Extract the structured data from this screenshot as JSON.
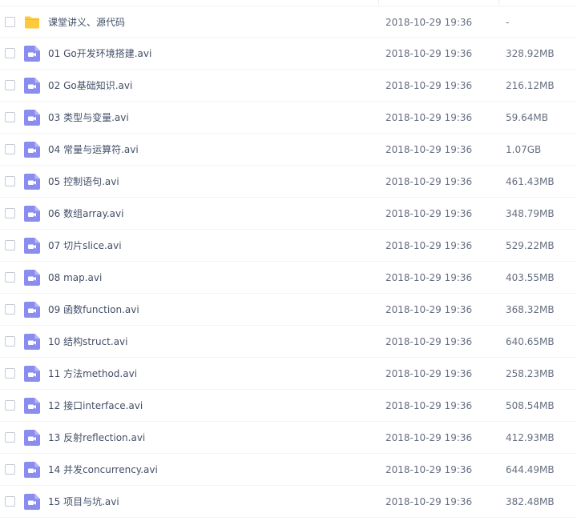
{
  "icon_colors": {
    "folder": "#ffc93c",
    "video": "#8a8cf0"
  },
  "files": [
    {
      "name": "课堂讲义、源代码",
      "date": "2018-10-29 19:36",
      "size": "-",
      "icon": "folder-icon"
    },
    {
      "name": "01 Go开发环境搭建.avi",
      "date": "2018-10-29 19:36",
      "size": "328.92MB",
      "icon": "video-file-icon"
    },
    {
      "name": "02 Go基础知识.avi",
      "date": "2018-10-29 19:36",
      "size": "216.12MB",
      "icon": "video-file-icon"
    },
    {
      "name": "03 类型与变量.avi",
      "date": "2018-10-29 19:36",
      "size": "59.64MB",
      "icon": "video-file-icon"
    },
    {
      "name": "04 常量与运算符.avi",
      "date": "2018-10-29 19:36",
      "size": "1.07GB",
      "icon": "video-file-icon"
    },
    {
      "name": "05 控制语句.avi",
      "date": "2018-10-29 19:36",
      "size": "461.43MB",
      "icon": "video-file-icon"
    },
    {
      "name": "06 数组array.avi",
      "date": "2018-10-29 19:36",
      "size": "348.79MB",
      "icon": "video-file-icon"
    },
    {
      "name": "07 切片slice.avi",
      "date": "2018-10-29 19:36",
      "size": "529.22MB",
      "icon": "video-file-icon"
    },
    {
      "name": "08 map.avi",
      "date": "2018-10-29 19:36",
      "size": "403.55MB",
      "icon": "video-file-icon"
    },
    {
      "name": "09 函数function.avi",
      "date": "2018-10-29 19:36",
      "size": "368.32MB",
      "icon": "video-file-icon"
    },
    {
      "name": "10 结构struct.avi",
      "date": "2018-10-29 19:36",
      "size": "640.65MB",
      "icon": "video-file-icon"
    },
    {
      "name": "11 方法method.avi",
      "date": "2018-10-29 19:36",
      "size": "258.23MB",
      "icon": "video-file-icon"
    },
    {
      "name": "12 接口interface.avi",
      "date": "2018-10-29 19:36",
      "size": "508.54MB",
      "icon": "video-file-icon"
    },
    {
      "name": "13 反射reflection.avi",
      "date": "2018-10-29 19:36",
      "size": "412.93MB",
      "icon": "video-file-icon"
    },
    {
      "name": "14 并发concurrency.avi",
      "date": "2018-10-29 19:36",
      "size": "644.49MB",
      "icon": "video-file-icon"
    },
    {
      "name": "15 项目与坑.avi",
      "date": "2018-10-29 19:36",
      "size": "382.48MB",
      "icon": "video-file-icon"
    }
  ]
}
